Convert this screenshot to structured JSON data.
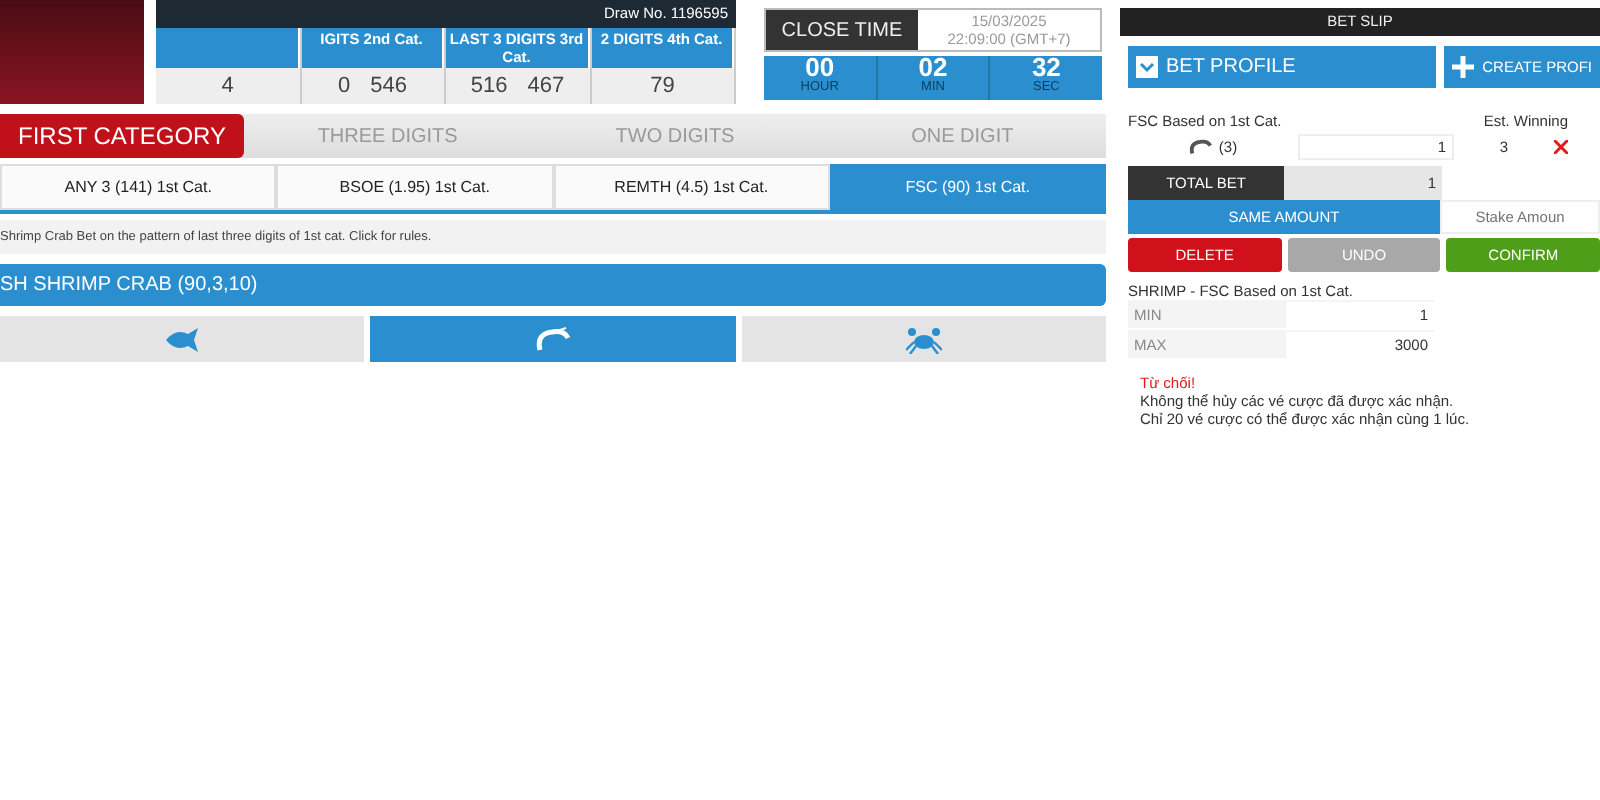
{
  "draw_info": "Draw No. 1196595",
  "results": [
    {
      "values": [
        "4"
      ]
    },
    {
      "header": "IGITS 2nd Cat.",
      "values": [
        "0",
        "546"
      ]
    },
    {
      "header": "LAST 3 DIGITS 3rd Cat.",
      "values": [
        "516",
        "467"
      ]
    },
    {
      "header": "2 DIGITS 4th Cat.",
      "values": [
        "79"
      ]
    }
  ],
  "close_time": {
    "label": "CLOSE TIME",
    "date": "15/03/2025",
    "time": "22:09:00 (GMT+7)",
    "countdown": [
      {
        "value": "00",
        "unit": "HOUR"
      },
      {
        "value": "02",
        "unit": "MIN"
      },
      {
        "value": "32",
        "unit": "SEC"
      }
    ]
  },
  "category_tabs": [
    {
      "label": "FIRST CATEGORY",
      "selected": true
    },
    {
      "label": "THREE DIGITS",
      "selected": false
    },
    {
      "label": "TWO DIGITS",
      "selected": false
    },
    {
      "label": "ONE DIGIT",
      "selected": false
    }
  ],
  "bet_tabs": [
    {
      "label": "ANY 3 (141) 1st Cat.",
      "selected": false
    },
    {
      "label": "BSOE (1.95) 1st Cat.",
      "selected": false
    },
    {
      "label": "REMTH (4.5) 1st Cat.",
      "selected": false
    },
    {
      "label": "FSC (90) 1st Cat.",
      "selected": true
    }
  ],
  "info_text": "Shrimp Crab Bet on the pattern of last three digits of 1st cat. Click for rules.",
  "game_title": "SH SHRIMP CRAB (90,3,10)",
  "choices": [
    {
      "kind": "fish",
      "selected": false
    },
    {
      "kind": "shrimp",
      "selected": true
    },
    {
      "kind": "crab",
      "selected": false
    }
  ],
  "bet_slip": {
    "title": "BET SLIP",
    "profile": "BET PROFILE",
    "create_profile": "CREATE PROFI",
    "bet_label": "FSC Based on 1st Cat.",
    "est_label": "Est. Winning",
    "line": {
      "kind": "shrimp",
      "count": "(3)",
      "stake": "1",
      "winning": "3"
    },
    "total_label": "TOTAL BET",
    "total_value": "1",
    "same_amount": "SAME AMOUNT",
    "stake_placeholder": "Stake Amoun",
    "buttons": [
      {
        "kind": "delete",
        "label": "DELETE"
      },
      {
        "kind": "undo",
        "label": "UNDO"
      },
      {
        "kind": "confirm",
        "label": "CONFIRM"
      }
    ],
    "limits_title": "SHRIMP - FSC Based on 1st Cat.",
    "limits": [
      {
        "label": "MIN",
        "value": "1"
      },
      {
        "label": "MAX",
        "value": "3000"
      }
    ],
    "error_title": "Từ chối!",
    "error_lines": [
      "Không thể hủy các vé cược đã được xác nhận.",
      "Chỉ 20 vé cược có thể được xác nhận cùng 1 lúc."
    ]
  }
}
